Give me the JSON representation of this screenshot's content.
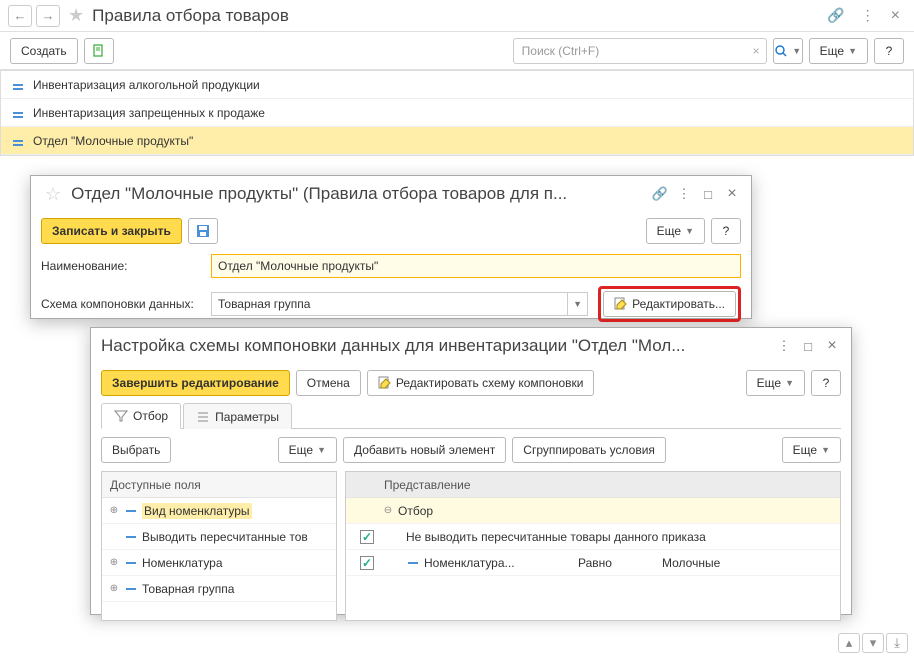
{
  "header": {
    "title": "Правила отбора товаров"
  },
  "toolbar": {
    "create": "Создать",
    "more": "Еще",
    "search_placeholder": "Поиск (Ctrl+F)",
    "help": "?"
  },
  "list": {
    "items": [
      {
        "label": "Инвентаризация алкогольной продукции"
      },
      {
        "label": "Инвентаризация запрещенных к продаже"
      },
      {
        "label": "Отдел \"Молочные продукты\""
      }
    ]
  },
  "modal1": {
    "title": "Отдел \"Молочные продукты\" (Правила отбора товаров для п...",
    "save_close": "Записать и закрыть",
    "more": "Еще",
    "help": "?",
    "name_label": "Наименование:",
    "name_value": "Отдел \"Молочные продукты\"",
    "schema_label": "Схема компоновки данных:",
    "schema_value": "Товарная группа",
    "edit_btn": "Редактировать..."
  },
  "modal2": {
    "title": "Настройка схемы компоновки данных для инвентаризации \"Отдел \"Мол...",
    "finish": "Завершить редактирование",
    "cancel": "Отмена",
    "edit_schema": "Редактировать схему компоновки",
    "more": "Еще",
    "help": "?",
    "tab_filter": "Отбор",
    "tab_params": "Параметры",
    "select": "Выбрать",
    "more2": "Еще",
    "add_new": "Добавить новый элемент",
    "group_cond": "Сгруппировать условия",
    "more3": "Еще",
    "left_header": "Доступные поля",
    "left_items": [
      "Вид номенклатуры",
      "Выводить пересчитанные тов",
      "Номенклатура",
      "Товарная группа"
    ],
    "right_header": "Представление",
    "filter_root": "Отбор",
    "filter1": "Не выводить пересчитанные товары данного приказа",
    "filter2_field": "Номенклатура...",
    "filter2_op": "Равно",
    "filter2_val": "Молочные"
  }
}
